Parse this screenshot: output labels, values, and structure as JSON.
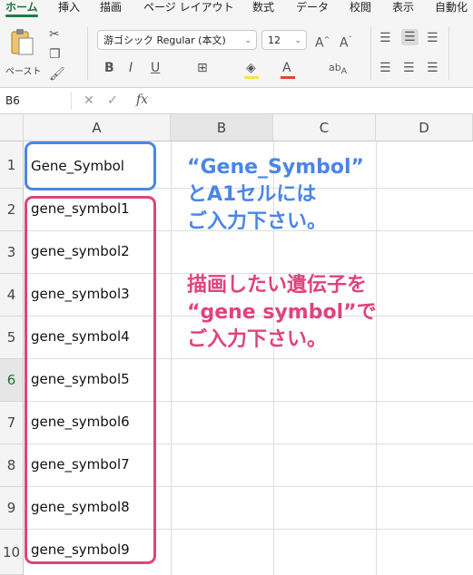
{
  "ribbon_tabs": [
    "ホーム",
    "挿入",
    "描画",
    "ページ レイアウト",
    "数式",
    "データ",
    "校閲",
    "表示",
    "自動化"
  ],
  "clipboard": {
    "paste_label": "ペースト"
  },
  "font": {
    "name": "游ゴシック Regular (本文)",
    "size": "12"
  },
  "formula_bar": {
    "name_box": "B6",
    "fx_label": "fx",
    "formula": ""
  },
  "sheet": {
    "columns": [
      "A",
      "B",
      "C",
      "D"
    ],
    "active_column": "B",
    "rows": [
      "1",
      "2",
      "3",
      "4",
      "5",
      "6",
      "7",
      "8",
      "9",
      "10"
    ],
    "active_row": "6",
    "A": [
      "Gene_Symbol",
      "gene_symbol1",
      "gene_symbol2",
      "gene_symbol3",
      "gene_symbol4",
      "gene_symbol5",
      "gene_symbol6",
      "gene_symbol7",
      "gene_symbol8",
      "gene_symbol9"
    ]
  },
  "annotations": {
    "header_note": [
      "“Gene_Symbol”",
      "とA1セルには",
      "ご入力下さい。"
    ],
    "list_note": [
      "描画したい遺伝子を",
      "“gene symbol”で",
      "ご入力下さい。"
    ],
    "colors": {
      "header_box": "#4a86e8",
      "list_box": "#e0437c"
    }
  },
  "icons": [
    "paste-icon",
    "cut-icon",
    "copy-icon",
    "format-painter-icon",
    "bold-icon",
    "italic-icon",
    "underline-icon",
    "border-icon",
    "fill-color-icon",
    "font-color-icon",
    "align-icon",
    "cancel-icon",
    "enter-icon"
  ]
}
